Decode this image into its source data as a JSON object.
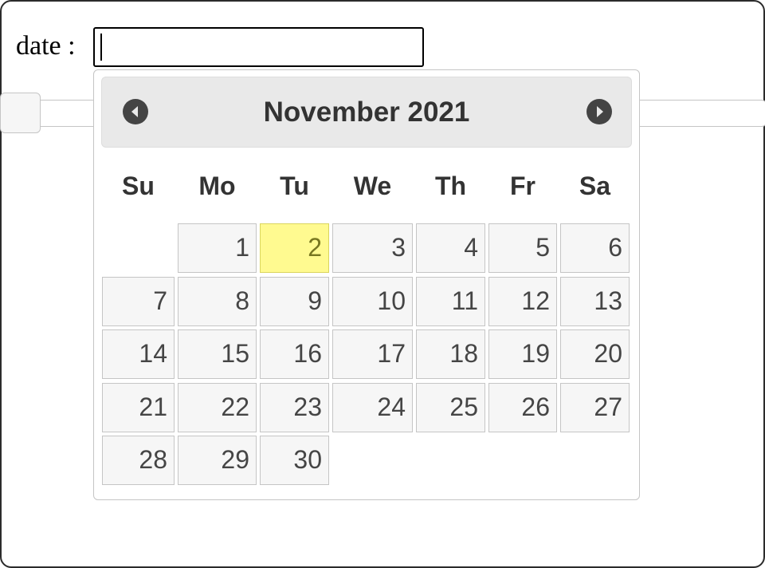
{
  "form": {
    "label": "date :",
    "input_value": ""
  },
  "datepicker": {
    "title": "November 2021",
    "prev_icon": "circle-triangle-west-icon",
    "next_icon": "circle-triangle-east-icon",
    "weekdays": [
      "Su",
      "Mo",
      "Tu",
      "We",
      "Th",
      "Fr",
      "Sa"
    ],
    "today": "2",
    "days": [
      "1",
      "2",
      "3",
      "4",
      "5",
      "6",
      "7",
      "8",
      "9",
      "10",
      "11",
      "12",
      "13",
      "14",
      "15",
      "16",
      "17",
      "18",
      "19",
      "20",
      "21",
      "22",
      "23",
      "24",
      "25",
      "26",
      "27",
      "28",
      "29",
      "30"
    ],
    "colors": {
      "header_bg": "#e9e9e9",
      "day_bg": "#f6f6f6",
      "today_bg": "#fffa90",
      "today_border": "#dad55e"
    }
  }
}
